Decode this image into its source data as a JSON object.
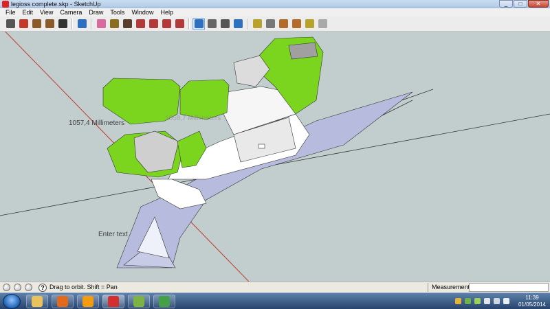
{
  "window": {
    "title": "legioss complete.skp - SketchUp",
    "minimize_symbol": "_",
    "maximize_symbol": "□",
    "close_symbol": "✕"
  },
  "menu": [
    "File",
    "Edit",
    "View",
    "Camera",
    "Draw",
    "Tools",
    "Window",
    "Help"
  ],
  "toolbar": {
    "tools": [
      {
        "icon": "select-arrow-icon",
        "color": "#555555"
      },
      {
        "icon": "pencil-line-icon",
        "color": "#c0392b"
      },
      {
        "icon": "rectangle-icon",
        "color": "#8b5a2b"
      },
      {
        "icon": "circle-icon",
        "color": "#8b5a2b"
      },
      {
        "icon": "arc-icon",
        "color": "#333333"
      },
      {
        "icon": "make-component-icon",
        "color": "#2e6fbf"
      },
      {
        "icon": "eraser-icon",
        "color": "#d96aa0"
      },
      {
        "icon": "tape-measure-icon",
        "color": "#8a6d1e"
      },
      {
        "icon": "paint-bucket-icon",
        "color": "#5a3d2b"
      },
      {
        "icon": "push-pull-icon",
        "color": "#b33a3a"
      },
      {
        "icon": "move-icon",
        "color": "#b33a3a"
      },
      {
        "icon": "rotate-icon",
        "color": "#b33a3a"
      },
      {
        "icon": "follow-me-icon",
        "color": "#b33a3a"
      },
      {
        "icon": "orbit-icon",
        "color": "#2e6fbf",
        "active": true
      },
      {
        "icon": "pan-hand-icon",
        "color": "#666666"
      },
      {
        "icon": "zoom-icon",
        "color": "#555555"
      },
      {
        "icon": "zoom-extents-icon",
        "color": "#2e6fbf"
      },
      {
        "icon": "add-location-icon",
        "color": "#b8a22b"
      },
      {
        "icon": "toggle-terrain-icon",
        "color": "#777777"
      },
      {
        "icon": "get-models-icon",
        "color": "#b36b2b"
      },
      {
        "icon": "share-model-icon",
        "color": "#b36b2b"
      },
      {
        "icon": "share-component-icon",
        "color": "#b8a22b"
      },
      {
        "icon": "extension-warehouse-icon",
        "color": "#a9a9a9"
      }
    ]
  },
  "viewport": {
    "background_color": "#c1cecd",
    "dimension_label": "1057,4 Millimeters",
    "ghost_dimension_label": "1058,7 Millimeters",
    "note_text": "Enter text",
    "model_green": "#7bd51f",
    "model_white": "#ffffff",
    "model_blue": "#b7bcde"
  },
  "statusbar": {
    "help_symbol": "?",
    "hint": "Drag to orbit.  Shift = Pan",
    "measurements_label": "Measurements",
    "measurements_value": ""
  },
  "taskbar": {
    "apps": [
      {
        "name": "file-explorer",
        "icon": "folder-icon",
        "color": "#e8c35b"
      },
      {
        "name": "firefox",
        "icon": "firefox-icon",
        "color": "#e26a1b"
      },
      {
        "name": "media-player",
        "icon": "media-player-icon",
        "color": "#f39c12"
      },
      {
        "name": "sketchup",
        "icon": "sketchup-icon",
        "color": "#d32f2f",
        "active": true
      },
      {
        "name": "app-globe",
        "icon": "globe-icon",
        "color": "#7cb342"
      },
      {
        "name": "app-feed",
        "icon": "feed-icon",
        "color": "#43a047"
      }
    ],
    "clock_time": "11:39",
    "clock_date": "01/05/2014"
  }
}
